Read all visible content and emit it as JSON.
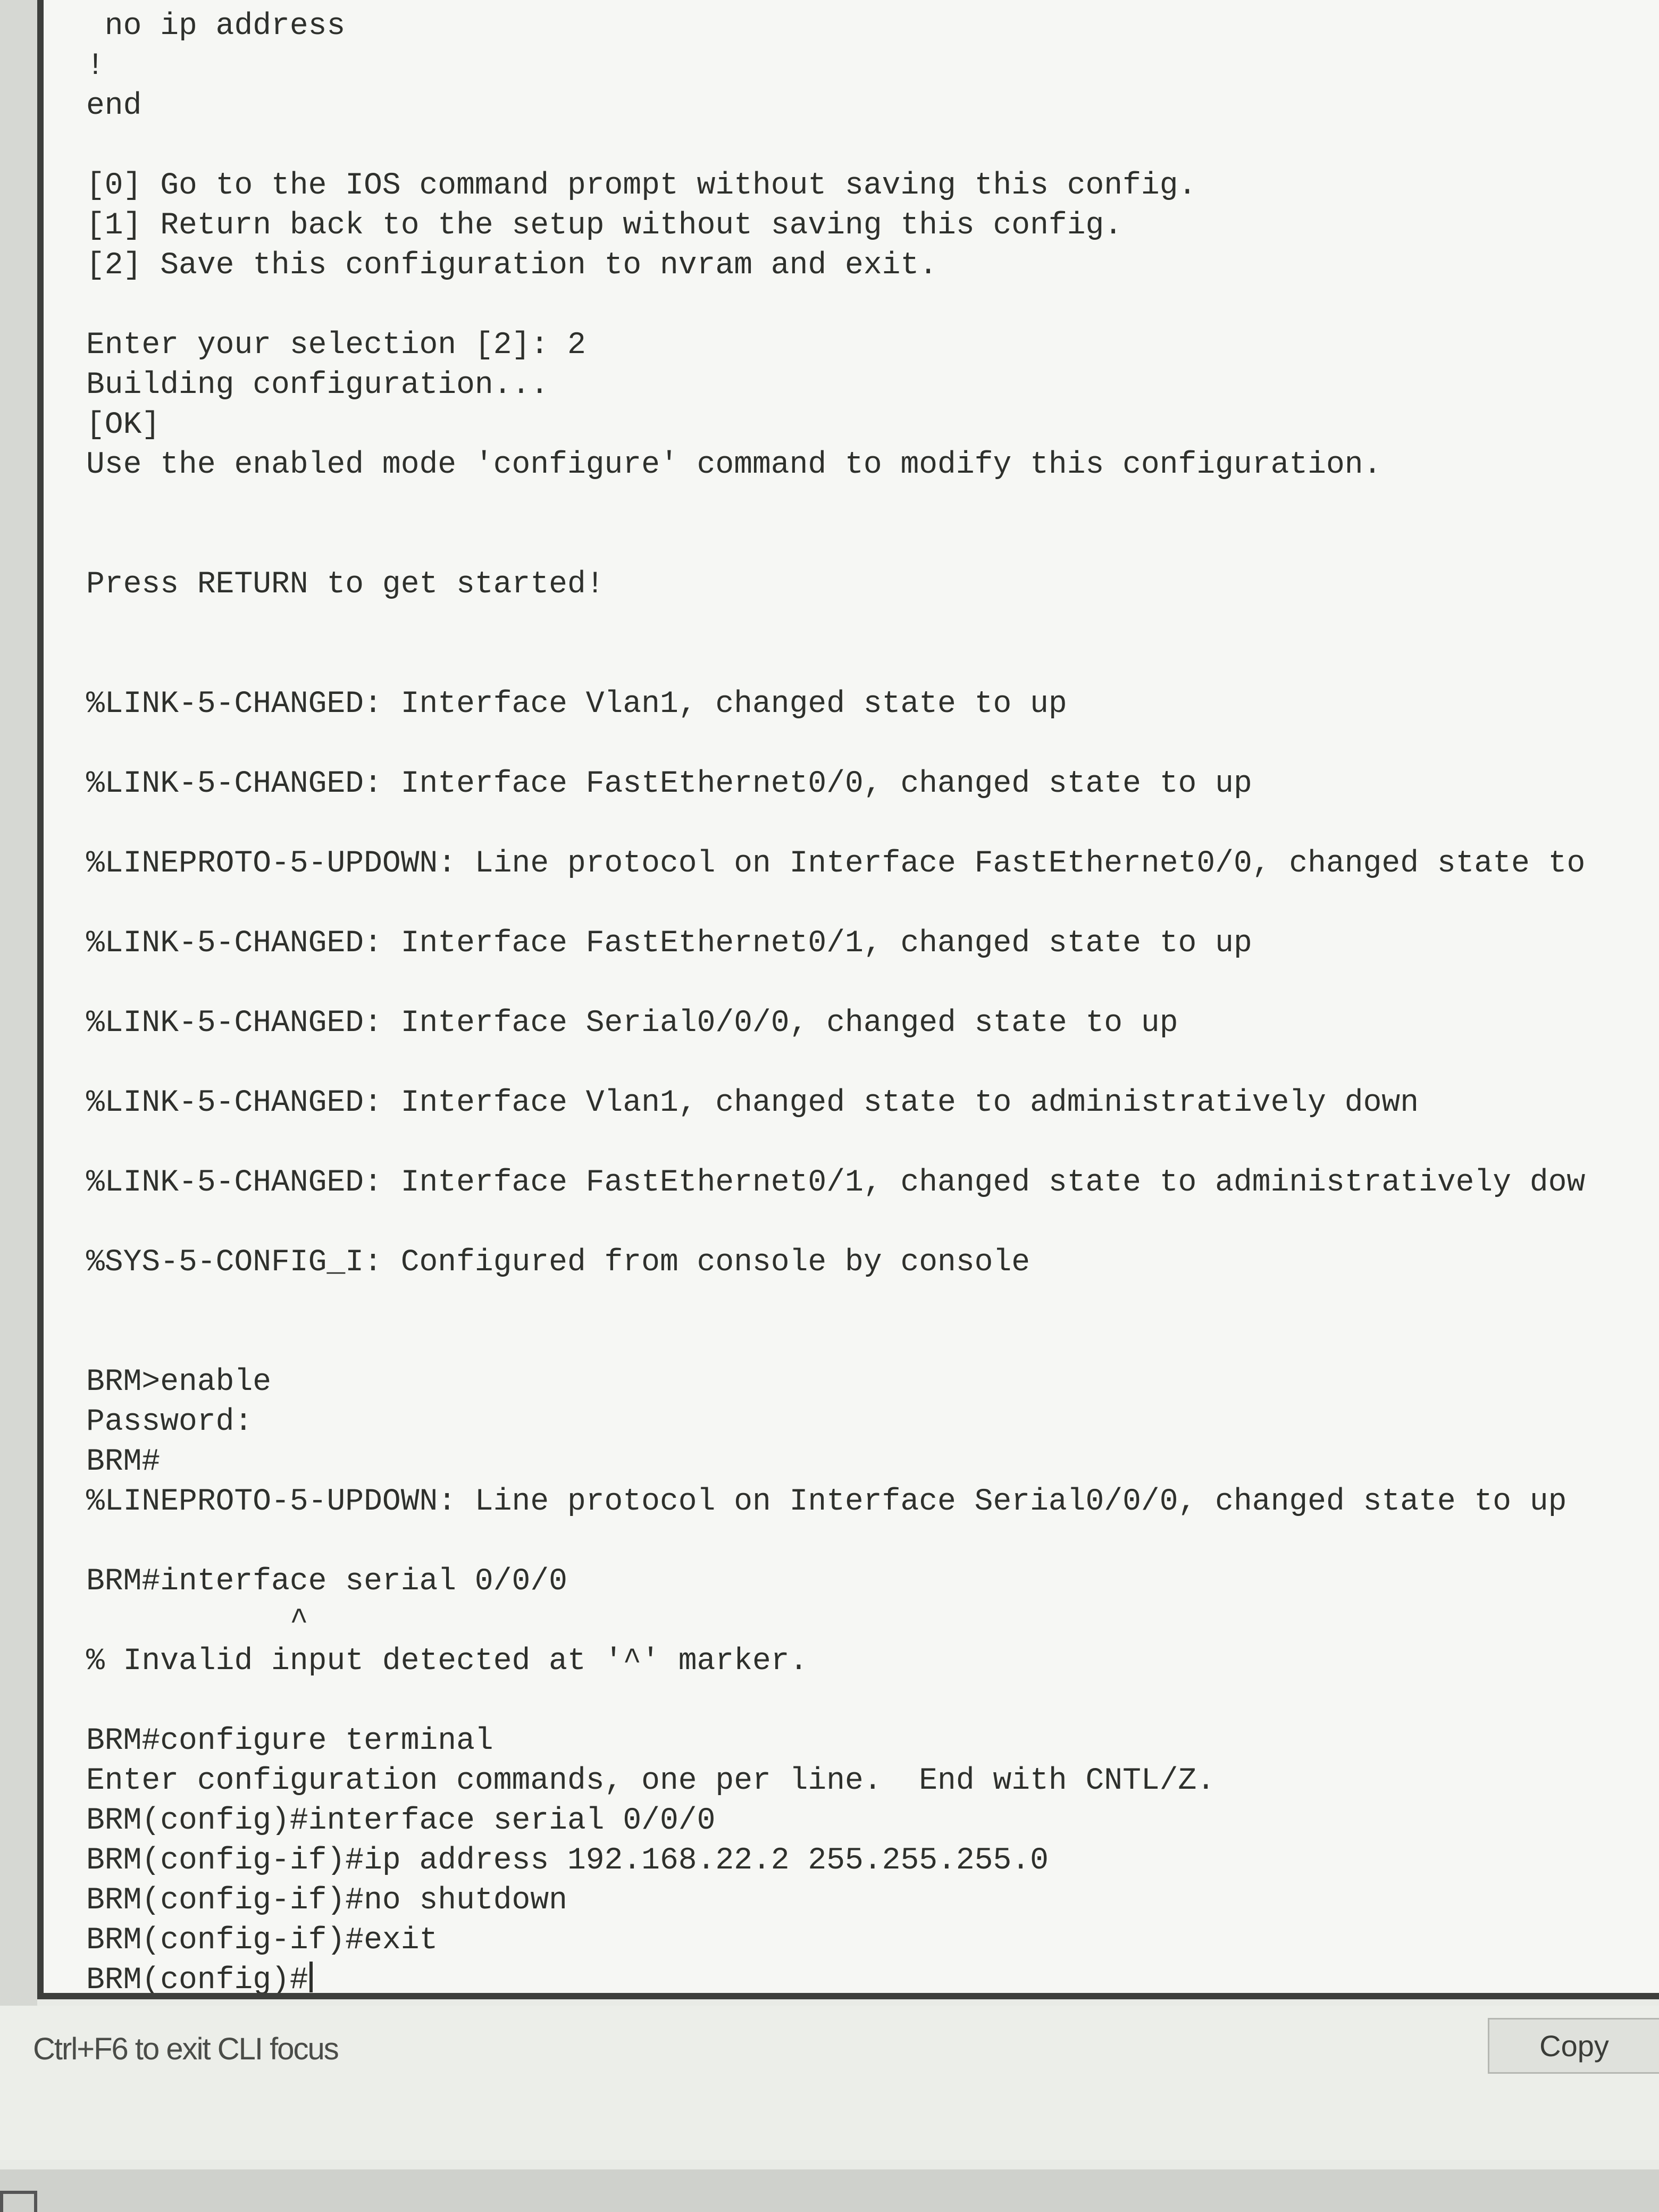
{
  "terminal": {
    "lines": [
      " no ip address",
      "!",
      "end",
      "",
      "[0] Go to the IOS command prompt without saving this config.",
      "[1] Return back to the setup without saving this config.",
      "[2] Save this configuration to nvram and exit.",
      "",
      "Enter your selection [2]: 2",
      "Building configuration...",
      "[OK]",
      "Use the enabled mode 'configure' command to modify this configuration.",
      "",
      "",
      "Press RETURN to get started!",
      "",
      "",
      "%LINK-5-CHANGED: Interface Vlan1, changed state to up",
      "",
      "%LINK-5-CHANGED: Interface FastEthernet0/0, changed state to up",
      "",
      "%LINEPROTO-5-UPDOWN: Line protocol on Interface FastEthernet0/0, changed state to",
      "",
      "%LINK-5-CHANGED: Interface FastEthernet0/1, changed state to up",
      "",
      "%LINK-5-CHANGED: Interface Serial0/0/0, changed state to up",
      "",
      "%LINK-5-CHANGED: Interface Vlan1, changed state to administratively down",
      "",
      "%LINK-5-CHANGED: Interface FastEthernet0/1, changed state to administratively dow",
      "",
      "%SYS-5-CONFIG_I: Configured from console by console",
      "",
      "",
      "BRM>enable",
      "Password:",
      "BRM#",
      "%LINEPROTO-5-UPDOWN: Line protocol on Interface Serial0/0/0, changed state to up",
      "",
      "BRM#interface serial 0/0/0",
      "           ^",
      "% Invalid input detected at '^' marker.",
      "",
      "BRM#configure terminal",
      "Enter configuration commands, one per line.  End with CNTL/Z.",
      "BRM(config)#interface serial 0/0/0",
      "BRM(config-if)#ip address 192.168.22.2 255.255.255.0",
      "BRM(config-if)#no shutdown",
      "BRM(config-if)#exit"
    ],
    "prompt": "BRM(config)#"
  },
  "status": {
    "hint": "Ctrl+F6 to exit CLI focus",
    "copy_label": "Copy"
  }
}
